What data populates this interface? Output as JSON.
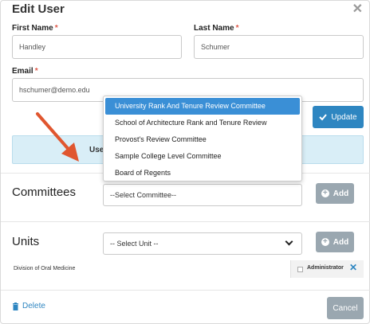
{
  "dialog": {
    "title": "Edit User"
  },
  "form": {
    "first_name_label": "First Name",
    "first_name_value": "Handley",
    "last_name_label": "Last Name",
    "last_name_value": "Schumer",
    "email_label": "Email",
    "email_value": "hschumer@demo.edu",
    "required_mark": "*",
    "update_label": "Update"
  },
  "info_panel": {
    "text": "User"
  },
  "committees": {
    "title": "Committees",
    "select_placeholder": "--Select Committee--",
    "add_label": "Add",
    "dropdown_options": [
      "University Rank And Tenure Review Committee",
      "School of Architecture Rank and Tenure Review",
      "Provost's Review Committee",
      "Sample College Level Committee",
      "Board of Regents"
    ],
    "highlighted_index": 0
  },
  "units": {
    "title": "Units",
    "select_placeholder": "-- Select Unit --",
    "add_label": "Add",
    "rows": [
      {
        "name": "Division of Oral Medicine",
        "role_label": "Administrator"
      }
    ]
  },
  "footer": {
    "delete_label": "Delete",
    "cancel_label": "Cancel"
  },
  "colors": {
    "accent": "#2e86c1",
    "dropdown_highlight": "#3a8fd6",
    "gray_button": "#9aa7b0",
    "info_panel_bg": "#d9eef7",
    "annotation_arrow": "#e0562f",
    "required": "#e05a4a"
  }
}
